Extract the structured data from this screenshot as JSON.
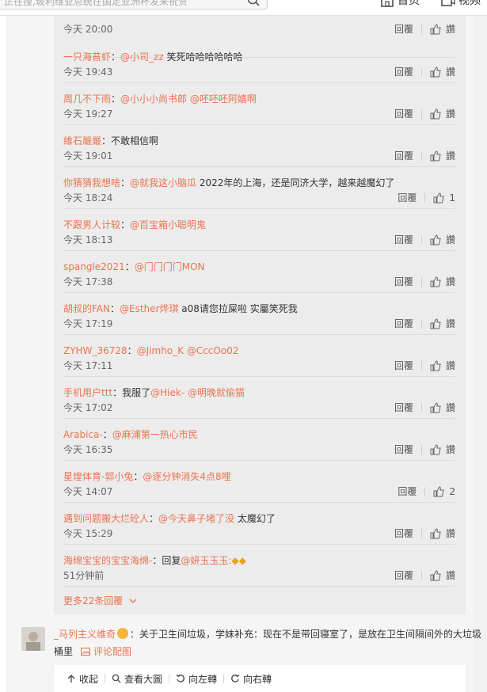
{
  "search": {
    "placeholder": "正在搜,玻利维亚总统在国足亚洲杯发来祝贺"
  },
  "top_nav": [
    {
      "label": "首页",
      "icon": "home-icon"
    },
    {
      "label": "视频",
      "icon": "video-icon"
    }
  ],
  "reply_actions": {
    "reply_label": "回覆"
  },
  "replies": [
    {
      "nick": "",
      "sep": "",
      "mentions": "",
      "content": "",
      "time": "今天 20:00",
      "likes": "讚"
    },
    {
      "nick": "一只海苔虾",
      "sep": "：",
      "mentions": "@小司_zz",
      "content": " 笑死哈哈哈哈哈哈",
      "time": "今天 19:43",
      "likes": "讚"
    },
    {
      "nick": "周几不下雨",
      "sep": "：",
      "mentions": "@小小小尚书郎 @呸呸呸阿嬉啊",
      "content": "",
      "time": "今天 19:27",
      "likes": "讚"
    },
    {
      "nick": "維石嚴嚴",
      "sep": "：",
      "mentions": "",
      "content": "不敢相信啊",
      "time": "今天 19:01",
      "likes": "讚"
    },
    {
      "nick": "你猜猜我想啥",
      "sep": "：",
      "mentions": "@就我这小脑瓜",
      "content": " 2022年的上海，还是同济大学，越来越魔幻了",
      "time": "今天 18:24",
      "likes": "1"
    },
    {
      "nick": "不跟男人计较",
      "sep": "：",
      "mentions": "@百宝箱小聪明鬼",
      "content": "",
      "time": "今天 18:13",
      "likes": "讚"
    },
    {
      "nick": "spangle2021",
      "sep": "：",
      "mentions": "@门门门门MON",
      "content": "",
      "time": "今天 17:38",
      "likes": "讚"
    },
    {
      "nick": "胡叔的FAN",
      "sep": "：",
      "mentions": "@Esther烨琪",
      "content": " a08请您拉屎啦 实屬笑死我",
      "time": "今天 17:19",
      "likes": "讚"
    },
    {
      "nick": "ZYHW_36728",
      "sep": "：",
      "mentions": "@Jimho_K @CccOo02",
      "content": "",
      "time": "今天 17:11",
      "likes": "讚"
    },
    {
      "nick": "手机用户ttt",
      "sep": "：",
      "mentions": "",
      "content": "我服了",
      "mentions2": "@Hiek- @明晚就偷猫",
      "time": "今天 17:02",
      "likes": "讚"
    },
    {
      "nick": "Arabica-",
      "sep": "：",
      "mentions": "@麻浦第一热心市民",
      "content": "",
      "time": "今天 16:35",
      "likes": "讚"
    },
    {
      "nick": "星煌体育-郭小兔",
      "sep": "：",
      "mentions": "@逐分钟消失4点8哩",
      "content": "",
      "time": "今天 14:07",
      "likes": "2"
    },
    {
      "nick": "遇到问题搬大烂砼人",
      "sep": "：",
      "mentions": "@今天鼻子堵了没",
      "content": " 太魔幻了",
      "time": "今天 15:29",
      "likes": "讚"
    },
    {
      "nick": "海绵宝宝的宝宝海绵-",
      "sep": "：",
      "mentions": "",
      "content": "回复",
      "mentions2": "@妍玉玉玉:",
      "time": "51分钟前",
      "likes": "讚"
    }
  ],
  "more_replies": "更多22条回覆",
  "main_comment": {
    "nick": "_马列主义维奇",
    "text": "：关于卫生间垃圾，学妹补充：现在不是带回寝室了，是放在卫生间隔间外的大垃圾桶里",
    "image_link": "评论配图"
  },
  "toolbar": [
    "收起",
    "查看大圖",
    "向左轉",
    "向右轉"
  ],
  "colors": {
    "accent": "#eb7350",
    "reply_bg": "#ececec",
    "page_bg": "#f5f5f5"
  }
}
